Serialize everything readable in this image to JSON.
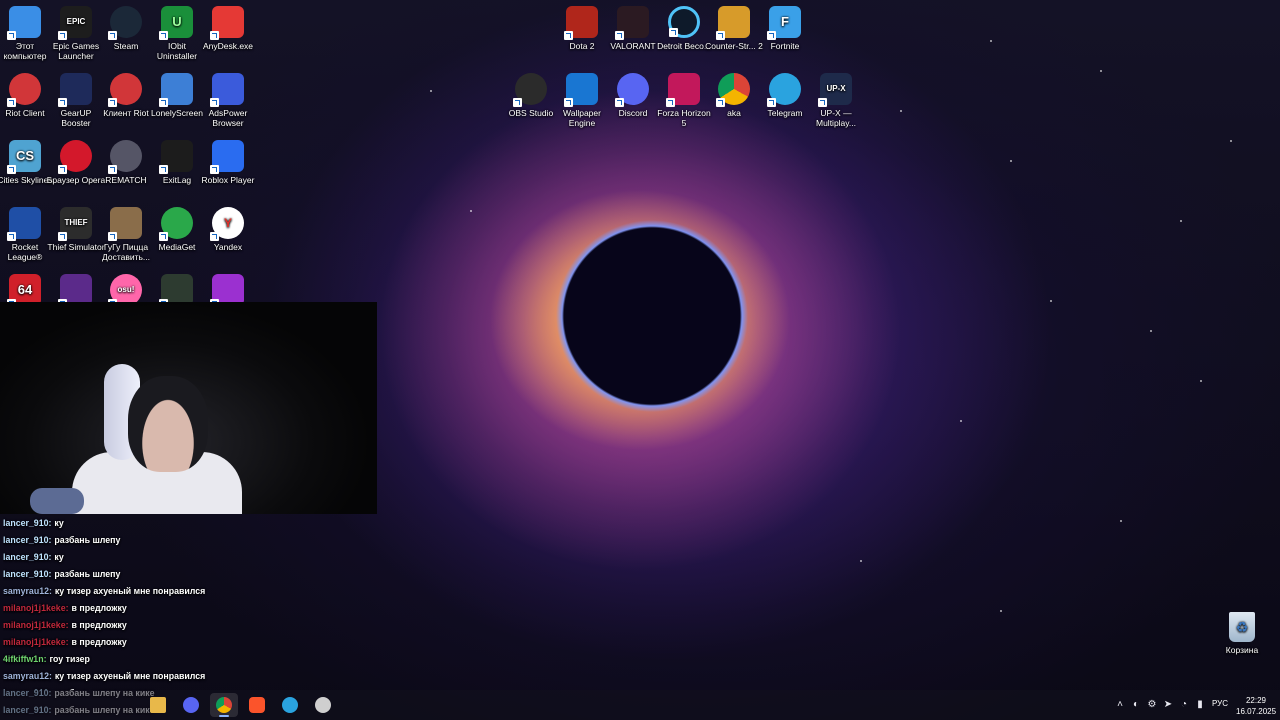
{
  "desktop_icons": [
    {
      "label": "Этот компьютер",
      "icon": "computer-icon",
      "color": "#3a8ee6"
    },
    {
      "label": "Epic Games Launcher",
      "icon": "epic-games-icon",
      "color": "#1d1d1d",
      "glyph": "EPIC"
    },
    {
      "label": "Steam",
      "icon": "steam-icon",
      "color": "#1b2838"
    },
    {
      "label": "IObit Uninstaller",
      "icon": "iobit-icon",
      "color": "#1a8f3a",
      "glyph": "U"
    },
    {
      "label": "AnyDesk.exe",
      "icon": "anydesk-icon",
      "color": "#e53935"
    },
    {
      "label": "Riot Client",
      "icon": "riot-client-icon",
      "color": "#d13639"
    },
    {
      "label": "GearUP Booster",
      "icon": "gearup-icon",
      "color": "#1e2a5a"
    },
    {
      "label": "Клиент Riot",
      "icon": "riot-client-icon",
      "color": "#d13639"
    },
    {
      "label": "LonelyScreen",
      "icon": "lonelyscreen-icon",
      "color": "#3d7fd6"
    },
    {
      "label": "AdsPower Browser",
      "icon": "adspower-icon",
      "color": "#3b5bdb"
    },
    {
      "label": "Cities Skylines",
      "icon": "cities-skylines-icon",
      "color": "#4fa3d1",
      "glyph": "CS"
    },
    {
      "label": "Браузер Opera",
      "icon": "opera-icon",
      "color": "#d3182b"
    },
    {
      "label": "REMATCH",
      "icon": "rematch-icon",
      "color": "#556"
    },
    {
      "label": "ExitLag",
      "icon": "exitlag-icon",
      "color": "#1c1c1c"
    },
    {
      "label": "Roblox Player",
      "icon": "roblox-icon",
      "color": "#2a6cf0"
    },
    {
      "label": "Rocket League®",
      "icon": "rocket-league-icon",
      "color": "#1f4fa6"
    },
    {
      "label": "Thief Simulator",
      "icon": "thief-simulator-icon",
      "color": "#2c2c2c",
      "glyph": "THIEF"
    },
    {
      "label": "ГуГу Пицца Доставить...",
      "icon": "pizza-game-icon",
      "color": "#8a6d4a"
    },
    {
      "label": "MediaGet",
      "icon": "mediaget-icon",
      "color": "#2aa84a"
    },
    {
      "label": "Yandex",
      "icon": "yandex-icon",
      "color": "#ffffff"
    },
    {
      "label": "",
      "icon": "game-64-icon",
      "color": "#d0202a",
      "glyph": "64"
    },
    {
      "label": "",
      "icon": "emoji-game-icon",
      "color": "#5b2a8a"
    },
    {
      "label": "",
      "icon": "osu-icon",
      "color": "#ff66aa",
      "glyph": "osu!"
    },
    {
      "label": "",
      "icon": "game-icon",
      "color": "#2d3b30"
    },
    {
      "label": "",
      "icon": "game-icon",
      "color": "#9b30d0"
    },
    {
      "label": "Dota 2",
      "icon": "dota2-icon",
      "color": "#b0261b"
    },
    {
      "label": "VALORANT",
      "icon": "valorant-icon",
      "color": "#2b1a22"
    },
    {
      "label": "Detroit Beco...",
      "icon": "detroit-icon",
      "color": "#0e1a2a"
    },
    {
      "label": "Counter-Str... 2",
      "icon": "cs2-icon",
      "color": "#d79b2a"
    },
    {
      "label": "Fortnite",
      "icon": "fortnite-icon",
      "color": "#3aa0e8",
      "glyph": "F"
    },
    {
      "label": "OBS Studio",
      "icon": "obs-icon",
      "color": "#2b2b2b"
    },
    {
      "label": "Wallpaper Engine",
      "icon": "wallpaper-engine-icon",
      "color": "#1976d2"
    },
    {
      "label": "Discord",
      "icon": "discord-icon",
      "color": "#5865f2"
    },
    {
      "label": "Forza Horizon 5",
      "icon": "forza-icon",
      "color": "#c2185b"
    },
    {
      "label": "aka",
      "icon": "chrome-icon",
      "color": "#ffffff"
    },
    {
      "label": "Telegram",
      "icon": "telegram-icon",
      "color": "#2aa3df"
    },
    {
      "label": "UP-X — Multiplay...",
      "icon": "upx-icon",
      "color": "#1e2a4a",
      "glyph": "UP-X"
    }
  ],
  "recycle_bin": {
    "label": "Корзина",
    "icon": "recycle-bin-icon"
  },
  "chat": [
    {
      "user": "lancer_910:",
      "message": "ку",
      "color": "#bfe3ff"
    },
    {
      "user": "lancer_910:",
      "message": "разбань шлепу",
      "color": "#bfe3ff"
    },
    {
      "user": "lancer_910:",
      "message": "ку",
      "color": "#bfe3ff"
    },
    {
      "user": "lancer_910:",
      "message": "разбань шлепу",
      "color": "#bfe3ff"
    },
    {
      "user": "samyrau12:",
      "message": "ку тизер ахуеный мне понравился",
      "color": "#9fb3d9"
    },
    {
      "user": "milanoj1j1keke:",
      "message": "в предложку",
      "color": "#c0283c"
    },
    {
      "user": "milanoj1j1keke:",
      "message": "в предложку",
      "color": "#c0283c"
    },
    {
      "user": "milanoj1j1keke:",
      "message": "в предложку",
      "color": "#c0283c"
    },
    {
      "user": "4ifkiffw1n:",
      "message": "гоу тизер",
      "color": "#6fd36f"
    },
    {
      "user": "samyrau12:",
      "message": "ку тизер ахуеный мне понравился",
      "color": "#9fb3d9"
    },
    {
      "user": "lancer_910:",
      "message": "разбань шлепу на кике",
      "color": "#bfe3ff"
    },
    {
      "user": "lancer_910:",
      "message": "разбань шлепу на кике",
      "color": "#bfe3ff"
    }
  ],
  "taskbar": {
    "apps": [
      {
        "icon": "file-explorer-icon",
        "color": "#e8b84a",
        "active": false
      },
      {
        "icon": "discord-icon",
        "color": "#5865f2",
        "active": false
      },
      {
        "icon": "chrome-icon",
        "color": "#4285f4",
        "active": true
      },
      {
        "icon": "brave-icon",
        "color": "#fb542b",
        "active": false
      },
      {
        "icon": "telegram-icon",
        "color": "#2aa3df",
        "active": false
      },
      {
        "icon": "obs-icon",
        "color": "#cfcfcf",
        "active": false
      }
    ],
    "tray_icons": [
      "chevron-up-icon",
      "steam-tray-icon",
      "steam-icon",
      "telegram-icon",
      "wifi-icon",
      "volume-icon",
      "microphone-icon"
    ],
    "language": "РУС",
    "time": "22:29",
    "date": "16.07.2025"
  }
}
